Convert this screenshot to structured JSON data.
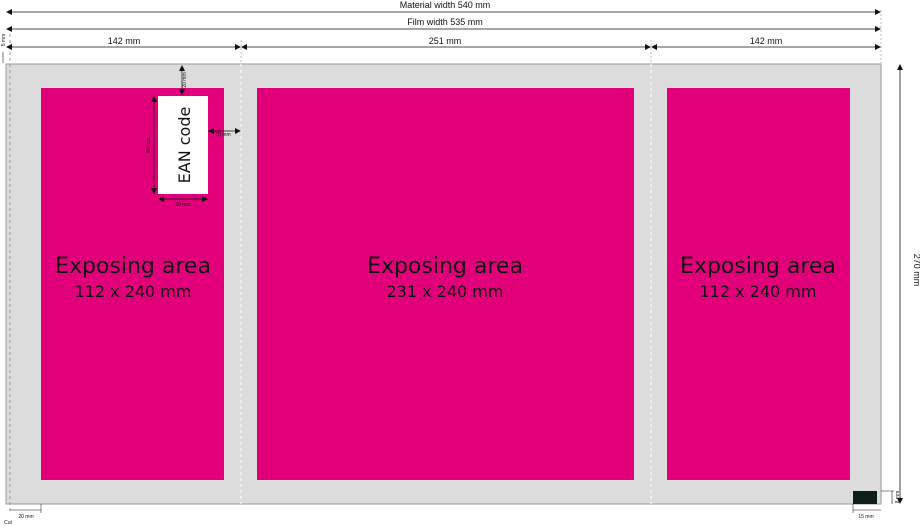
{
  "dimensions": {
    "material_width": "Material width 540 mm",
    "film_width": "Film width 535 mm",
    "panel_left_width": "142 mm",
    "panel_center_width": "251 mm",
    "panel_right_width": "142 mm",
    "top_margin": "5 mm",
    "height": "270 mm",
    "bottom_left_offset": "20 mm",
    "bottom_right_offset": "15 mm",
    "marker_height": "8 mm",
    "cut_label": "Cut"
  },
  "ean": {
    "label": "EAN code",
    "top_offset": "20 mm",
    "height": "60 mm",
    "width": "30 mm",
    "right_offset": "10 mm"
  },
  "areas": [
    {
      "title": "Exposing area",
      "size": "112 x 240 mm"
    },
    {
      "title": "Exposing area",
      "size": "231 x 240 mm"
    },
    {
      "title": "Exposing area",
      "size": "112 x 240 mm"
    }
  ],
  "colors": {
    "material": "#dcdcdc",
    "exposing": "#e2007a",
    "marker": "#0d1f17",
    "line": "#111111"
  }
}
